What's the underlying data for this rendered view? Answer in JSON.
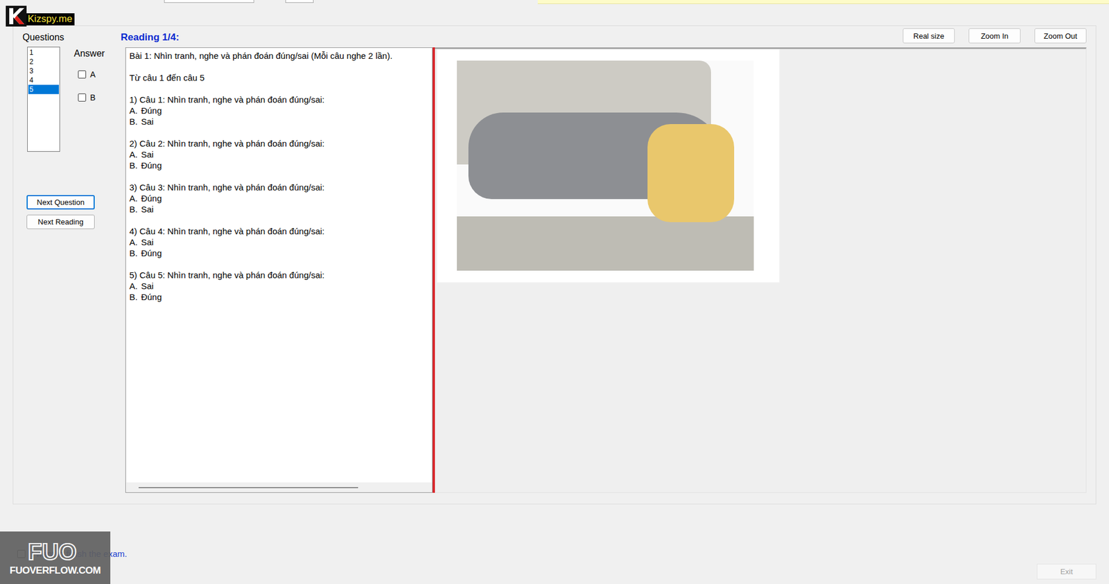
{
  "header": {
    "questions_label": "Questions",
    "answer_label": "Answer",
    "reading_title": "Reading 1/4:"
  },
  "question_list": [
    {
      "label": "1",
      "selected": false
    },
    {
      "label": "2",
      "selected": false
    },
    {
      "label": "3",
      "selected": false
    },
    {
      "label": "4",
      "selected": false
    },
    {
      "label": "5",
      "selected": true
    }
  ],
  "answers": [
    {
      "label": "A",
      "checked": false
    },
    {
      "label": "B",
      "checked": false
    }
  ],
  "nav_buttons": [
    "Next Question",
    "Next Reading"
  ],
  "zoom_buttons": [
    "Real size",
    "Zoom In",
    "Zoom Out"
  ],
  "reading": {
    "intro": "Bài 1: Nhìn tranh, nghe và phán đoán đúng/sai (Mỗi câu nghe 2 lần).",
    "range": "Từ câu 1 đến câu 5",
    "questions": [
      {
        "prompt": "1) Câu 1: Nhìn tranh, nghe và phán đoán đúng/sai:",
        "options": [
          {
            "letter": "A.",
            "text": "Đúng"
          },
          {
            "letter": "B.",
            "text": "Sai"
          }
        ]
      },
      {
        "prompt": "2) Câu 2: Nhìn tranh, nghe và phán đoán đúng/sai:",
        "options": [
          {
            "letter": "A.",
            "text": "Sai"
          },
          {
            "letter": "B.",
            "text": "Đúng"
          }
        ]
      },
      {
        "prompt": "3) Câu 3: Nhìn tranh, nghe và phán đoán đúng/sai:",
        "options": [
          {
            "letter": "A.",
            "text": "Đúng"
          },
          {
            "letter": "B.",
            "text": "Sai"
          }
        ]
      },
      {
        "prompt": "4) Câu 4: Nhìn tranh, nghe và phán đoán đúng/sai:",
        "options": [
          {
            "letter": "A.",
            "text": "Sai"
          },
          {
            "letter": "B.",
            "text": "Đúng"
          }
        ]
      },
      {
        "prompt": "5) Câu 5: Nhìn tranh, nghe và phán đoán đúng/sai:",
        "options": [
          {
            "letter": "A.",
            "text": "Sai"
          },
          {
            "letter": "B.",
            "text": "Đúng"
          }
        ]
      }
    ]
  },
  "finish": {
    "label": "I want to finish the exam.",
    "checked": false
  },
  "exit_button": {
    "label": "Exit",
    "disabled": true
  },
  "watermarks": {
    "top_logo": "Kizspy.me",
    "bottom_big": "FUO",
    "bottom_site": "FUOVERFLOW.COM"
  }
}
